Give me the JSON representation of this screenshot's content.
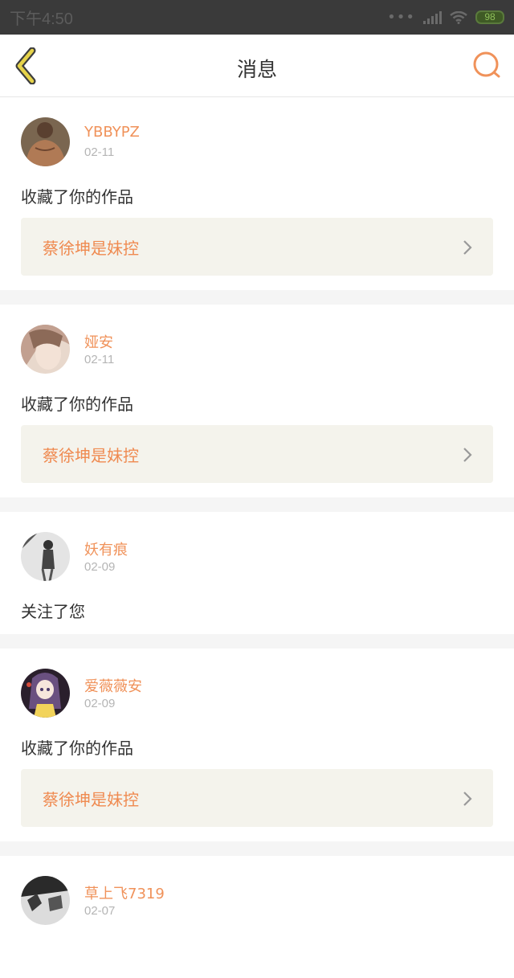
{
  "status_bar": {
    "time": "下午4:50",
    "battery": "98"
  },
  "header": {
    "title": "消息"
  },
  "colors": {
    "accent": "#ef8a50",
    "back_arrow": "#e6d34a",
    "card_bg": "#f4f3ec"
  },
  "messages": [
    {
      "user": "YBBYPZ",
      "date": "02-11",
      "action": "收藏了你的作品",
      "work_title": "蔡徐坤是妹控"
    },
    {
      "user": "娅安",
      "date": "02-11",
      "action": "收藏了你的作品",
      "work_title": "蔡徐坤是妹控"
    },
    {
      "user": "妖有痕",
      "date": "02-09",
      "action": "关注了您"
    },
    {
      "user": "爱薇薇安",
      "date": "02-09",
      "action": "收藏了你的作品",
      "work_title": "蔡徐坤是妹控"
    },
    {
      "user": "草上飞7319",
      "date": "02-07"
    }
  ]
}
